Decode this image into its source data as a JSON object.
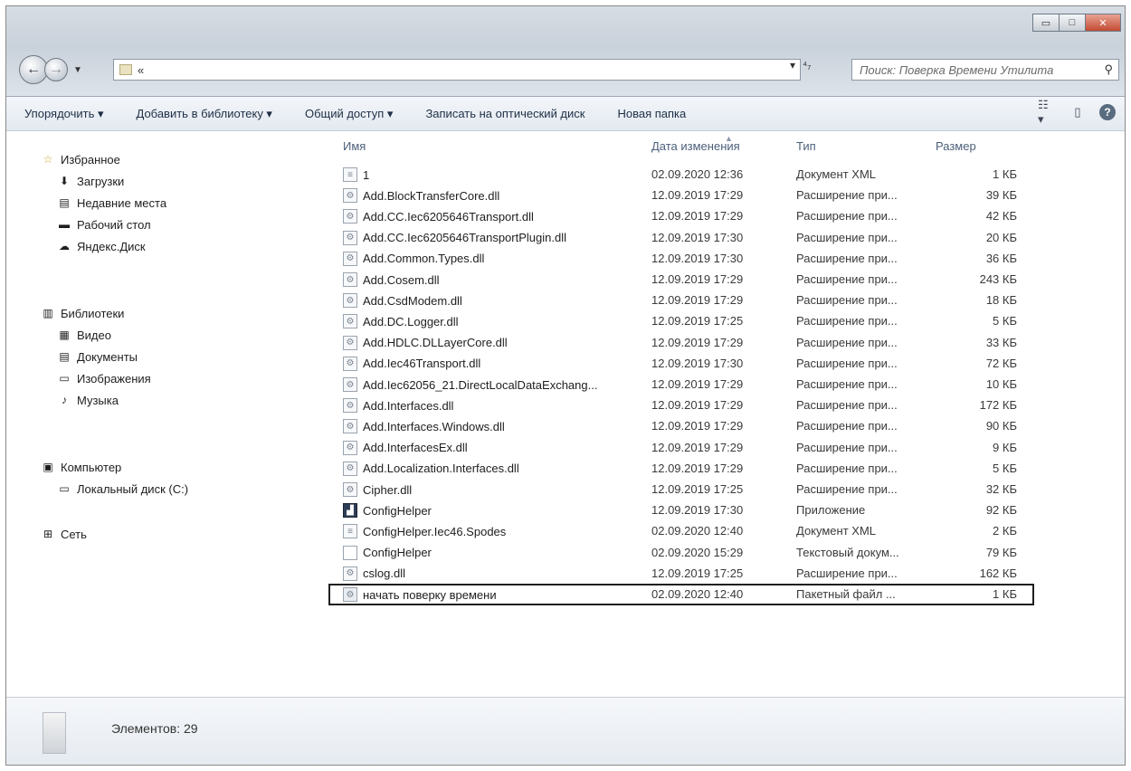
{
  "window": {
    "minimize_glyph": "▭",
    "maximize_glyph": "□",
    "close_glyph": "✕"
  },
  "address": {
    "path": "«",
    "dropdown_glyph": "▾",
    "refresh_glyph": "⁴₇"
  },
  "search": {
    "placeholder": "Поиск: Поверка Времени Утилита"
  },
  "toolbar": {
    "organize": "Упорядочить ▾",
    "add_to_library": "Добавить в библиотеку ▾",
    "share": "Общий доступ ▾",
    "burn": "Записать на оптический диск",
    "new_folder": "Новая папка"
  },
  "sidebar": {
    "favorites": {
      "label": "Избранное",
      "items": [
        "Загрузки",
        "Недавние места",
        "Рабочий стол",
        "Яндекс.Диск"
      ]
    },
    "libraries": {
      "label": "Библиотеки",
      "items": [
        "Видео",
        "Документы",
        "Изображения",
        "Музыка"
      ]
    },
    "computer": {
      "label": "Компьютер",
      "items": [
        "Локальный диск (C:)"
      ]
    },
    "network": {
      "label": "Сеть"
    }
  },
  "columns": {
    "name": "Имя",
    "date": "Дата изменения",
    "type": "Тип",
    "size": "Размер"
  },
  "files": [
    {
      "name": "1",
      "date": "02.09.2020 12:36",
      "type": "Документ XML",
      "size": "1 КБ",
      "icon": "xml-file-icon"
    },
    {
      "name": "Add.BlockTransferCore.dll",
      "date": "12.09.2019 17:29",
      "type": "Расширение при...",
      "size": "39 КБ",
      "icon": "dll-file-icon"
    },
    {
      "name": "Add.CC.Iec6205646Transport.dll",
      "date": "12.09.2019 17:29",
      "type": "Расширение при...",
      "size": "42 КБ",
      "icon": "dll-file-icon"
    },
    {
      "name": "Add.CC.Iec6205646TransportPlugin.dll",
      "date": "12.09.2019 17:30",
      "type": "Расширение при...",
      "size": "20 КБ",
      "icon": "dll-file-icon"
    },
    {
      "name": "Add.Common.Types.dll",
      "date": "12.09.2019 17:30",
      "type": "Расширение при...",
      "size": "36 КБ",
      "icon": "dll-file-icon"
    },
    {
      "name": "Add.Cosem.dll",
      "date": "12.09.2019 17:29",
      "type": "Расширение при...",
      "size": "243 КБ",
      "icon": "dll-file-icon"
    },
    {
      "name": "Add.CsdModem.dll",
      "date": "12.09.2019 17:29",
      "type": "Расширение при...",
      "size": "18 КБ",
      "icon": "dll-file-icon"
    },
    {
      "name": "Add.DC.Logger.dll",
      "date": "12.09.2019 17:25",
      "type": "Расширение при...",
      "size": "5 КБ",
      "icon": "dll-file-icon"
    },
    {
      "name": "Add.HDLC.DLLayerCore.dll",
      "date": "12.09.2019 17:29",
      "type": "Расширение при...",
      "size": "33 КБ",
      "icon": "dll-file-icon"
    },
    {
      "name": "Add.Iec46Transport.dll",
      "date": "12.09.2019 17:30",
      "type": "Расширение при...",
      "size": "72 КБ",
      "icon": "dll-file-icon"
    },
    {
      "name": "Add.Iec62056_21.DirectLocalDataExchang...",
      "date": "12.09.2019 17:29",
      "type": "Расширение при...",
      "size": "10 КБ",
      "icon": "dll-file-icon"
    },
    {
      "name": "Add.Interfaces.dll",
      "date": "12.09.2019 17:29",
      "type": "Расширение при...",
      "size": "172 КБ",
      "icon": "dll-file-icon"
    },
    {
      "name": "Add.Interfaces.Windows.dll",
      "date": "12.09.2019 17:29",
      "type": "Расширение при...",
      "size": "90 КБ",
      "icon": "dll-file-icon"
    },
    {
      "name": "Add.InterfacesEx.dll",
      "date": "12.09.2019 17:29",
      "type": "Расширение при...",
      "size": "9 КБ",
      "icon": "dll-file-icon"
    },
    {
      "name": "Add.Localization.Interfaces.dll",
      "date": "12.09.2019 17:29",
      "type": "Расширение при...",
      "size": "5 КБ",
      "icon": "dll-file-icon"
    },
    {
      "name": "Cipher.dll",
      "date": "12.09.2019 17:25",
      "type": "Расширение при...",
      "size": "32 КБ",
      "icon": "dll-file-icon"
    },
    {
      "name": "ConfigHelper",
      "date": "12.09.2019 17:30",
      "type": "Приложение",
      "size": "92 КБ",
      "icon": "application-icon"
    },
    {
      "name": "ConfigHelper.Iec46.Spodes",
      "date": "02.09.2020 12:40",
      "type": "Документ XML",
      "size": "2 КБ",
      "icon": "xml-file-icon"
    },
    {
      "name": "ConfigHelper",
      "date": "02.09.2020 15:29",
      "type": "Текстовый докум...",
      "size": "79 КБ",
      "icon": "text-file-icon"
    },
    {
      "name": "cslog.dll",
      "date": "12.09.2019 17:25",
      "type": "Расширение при...",
      "size": "162 КБ",
      "icon": "dll-file-icon"
    },
    {
      "name": "начать поверку времени",
      "date": "02.09.2020 12:40",
      "type": "Пакетный файл ...",
      "size": "1 КБ",
      "icon": "batch-file-icon",
      "highlighted": true
    }
  ],
  "status": {
    "count": "Элементов: 29"
  }
}
